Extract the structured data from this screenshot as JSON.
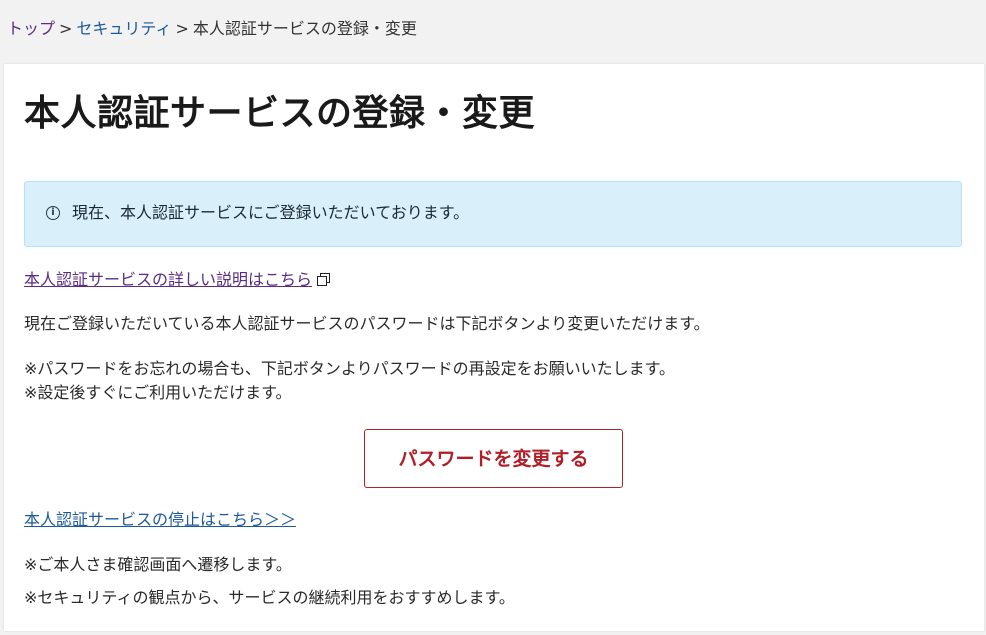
{
  "breadcrumb": {
    "top": "トップ",
    "security": "セキュリティ",
    "current": "本人認証サービスの登録・変更",
    "separator": ">"
  },
  "page": {
    "title": "本人認証サービスの登録・変更"
  },
  "info": {
    "icon": "info-icon",
    "icon_glyph": "i",
    "message": "現在、本人認証サービスにご登録いただいております。"
  },
  "detail_link": {
    "label": "本人認証サービスの詳しい説明はこちら",
    "icon": "external-link-icon"
  },
  "body": {
    "description": "現在ご登録いただいている本人認証サービスのパスワードは下記ボタンより変更いただけます。",
    "note_forgot": "※パスワードをお忘れの場合も、下記ボタンよりパスワードの再設定をお願いいたします。",
    "note_available": "※設定後すぐにご利用いただけます。"
  },
  "change_button": {
    "label": "パスワードを変更する"
  },
  "stop_link": {
    "label": "本人認証サービスの停止はこちら＞＞"
  },
  "notes": {
    "transition": "※ご本人さま確認画面へ遷移します。",
    "recommend": "※セキュリティの観点から、サービスの継続利用をおすすめします。"
  },
  "colors": {
    "background": "#f2f2f2",
    "card": "#ffffff",
    "info_bg": "#d9f0fb",
    "link_visited": "#5b2c83",
    "link": "#1d5a9a",
    "button_accent": "#b01e27"
  }
}
